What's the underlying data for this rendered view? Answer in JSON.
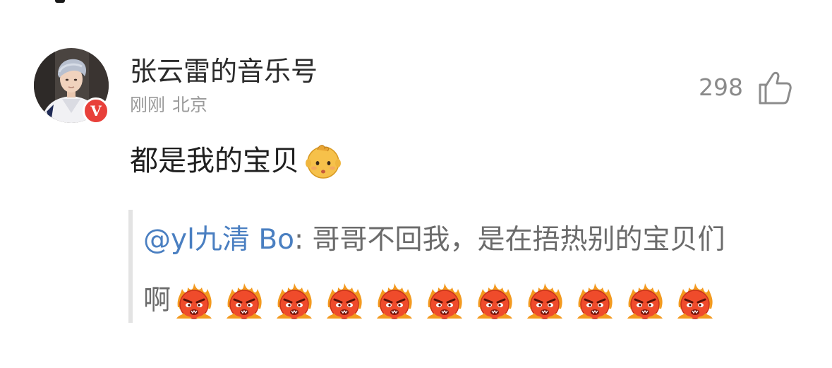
{
  "comment": {
    "user": {
      "name": "张云雷的音乐号",
      "verified_badge_text": "V",
      "avatar_icon": "user-avatar-photo"
    },
    "meta": {
      "time": "刚刚",
      "location": "北京"
    },
    "like": {
      "count": "298",
      "icon": "thumbs-up-icon"
    },
    "text": "都是我的宝贝",
    "text_emoji": "baby-face-emoji",
    "quote": {
      "mention": "@yl九清 Bo",
      "separator": ": ",
      "line1_text": "哥哥不回我，是在捂热别的宝贝们",
      "line2_text": "啊",
      "emoji": "angry-fire-emoji",
      "emoji_count": 11
    }
  },
  "colors": {
    "mention": "#4a7fc1",
    "verified_badge": "#e8403a",
    "meta_text": "#9a9a9a",
    "quote_bar": "#e3e3e3"
  }
}
